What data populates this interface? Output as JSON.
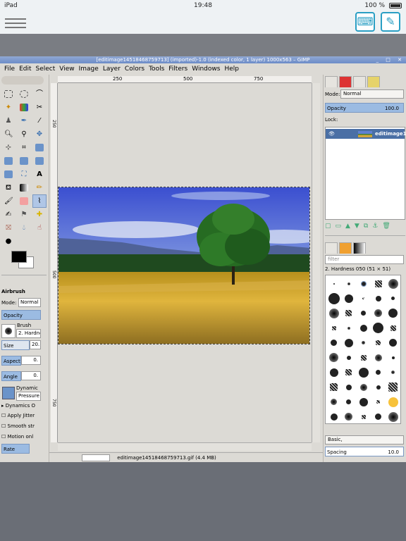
{
  "ios": {
    "carrier": "iPad",
    "time": "19:48",
    "battery": "100 %"
  },
  "gimp": {
    "title": "[editimage14518468759713] (imported)-1.0 (indexed color, 1 layer) 1000x563 – GIMP",
    "menu": [
      "File",
      "Edit",
      "Select",
      "View",
      "Image",
      "Layer",
      "Colors",
      "Tools",
      "Filters",
      "Windows",
      "Help"
    ],
    "ruler": {
      "h_ticks": [
        "250",
        "500",
        "750"
      ],
      "v_ticks": [
        "250",
        "500",
        "750"
      ]
    },
    "status": "editimage14518468759713.gif (4.4 MB)",
    "zoom_label": "",
    "tool_options": {
      "title": "Airbrush",
      "mode_label": "Mode:",
      "mode_value": "Normal",
      "opacity_label": "Opacity",
      "brush_label": "Brush",
      "brush_value": "2. Hardne",
      "size_label": "Size",
      "size_value": "20.",
      "aspect_label": "Aspect",
      "aspect_value": "0.",
      "angle_label": "Angle",
      "angle_value": "0.",
      "dynamics_label": "Dynamic",
      "dynamics_value": "Pressure",
      "dynamics_options": "Dynamics O",
      "jitter": "Apply Jitter",
      "smooth": "Smooth str",
      "motion": "Motion onl",
      "rate_label": "Rate"
    },
    "layers": {
      "mode_label": "Mode:",
      "mode_value": "Normal",
      "opacity_label": "Opacity",
      "opacity_value": "100.0",
      "lock_label": "Lock:",
      "layer_name": "editimage1"
    },
    "brushes": {
      "filter_placeholder": "filter",
      "selected": "2. Hardness 050 (51 × 51)",
      "preset": "Basic,",
      "spacing_label": "Spacing",
      "spacing_value": "10.0"
    }
  }
}
